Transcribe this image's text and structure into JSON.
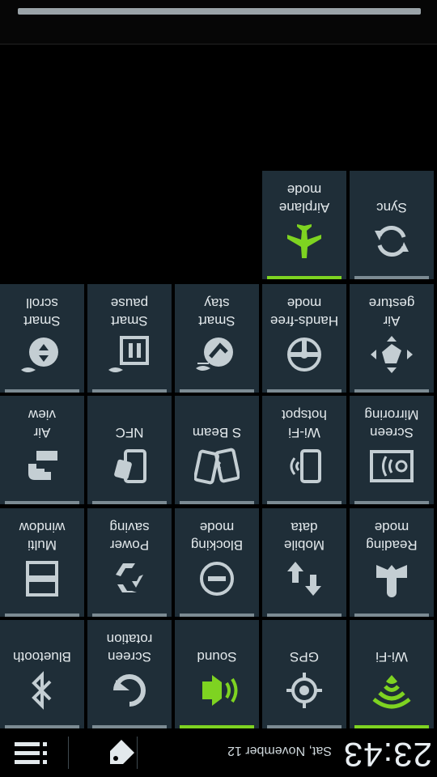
{
  "status": {
    "time": "23:43",
    "date": "Sat, November 12"
  },
  "colors": {
    "accent": "#7ed321",
    "tile_bg": "#1f2e38",
    "icon_off": "#c4ced3",
    "indicator_off": "#7c8b93"
  },
  "toggles": [
    {
      "label": "Wi-Fi",
      "icon": "wifi-icon",
      "on": true
    },
    {
      "label": "GPS",
      "icon": "gps-icon",
      "on": false
    },
    {
      "label": "Sound",
      "icon": "sound-icon",
      "on": true
    },
    {
      "label": "Screen\nrotation",
      "icon": "rotation-icon",
      "on": false
    },
    {
      "label": "Bluetooth",
      "icon": "bluetooth-icon",
      "on": false
    },
    {
      "label": "Reading\nmode",
      "icon": "reading-mode-icon",
      "on": false
    },
    {
      "label": "Mobile\ndata",
      "icon": "mobile-data-icon",
      "on": false
    },
    {
      "label": "Blocking\nmode",
      "icon": "blocking-mode-icon",
      "on": false
    },
    {
      "label": "Power\nsaving",
      "icon": "power-saving-icon",
      "on": false
    },
    {
      "label": "Multi\nwindow",
      "icon": "multi-window-icon",
      "on": false
    },
    {
      "label": "Screen\nMirroring",
      "icon": "screen-mirroring-icon",
      "on": false
    },
    {
      "label": "Wi-Fi\nhotspot",
      "icon": "hotspot-icon",
      "on": false
    },
    {
      "label": "S Beam",
      "icon": "s-beam-icon",
      "on": false
    },
    {
      "label": "NFC",
      "icon": "nfc-icon",
      "on": false
    },
    {
      "label": "Air\nview",
      "icon": "air-view-icon",
      "on": false
    },
    {
      "label": "Air\ngesture",
      "icon": "air-gesture-icon",
      "on": false
    },
    {
      "label": "Hands-free\nmode",
      "icon": "hands-free-icon",
      "on": false
    },
    {
      "label": "Smart\nstay",
      "icon": "smart-stay-icon",
      "on": false
    },
    {
      "label": "Smart\npause",
      "icon": "smart-pause-icon",
      "on": false
    },
    {
      "label": "Smart\nscroll",
      "icon": "smart-scroll-icon",
      "on": false
    },
    {
      "label": "Sync",
      "icon": "sync-icon",
      "on": false
    },
    {
      "label": "Airplane\nmode",
      "icon": "airplane-icon",
      "on": true
    }
  ]
}
